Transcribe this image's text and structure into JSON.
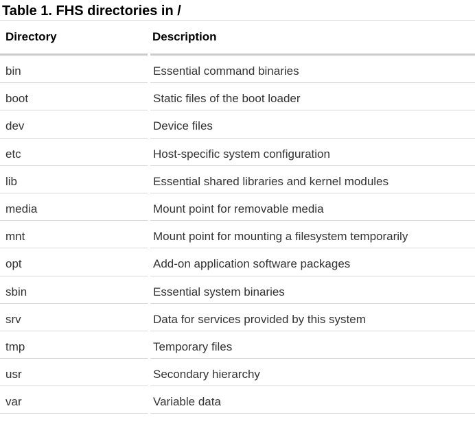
{
  "caption": "Table 1. FHS directories in /",
  "headers": {
    "directory": "Directory",
    "description": "Description"
  },
  "rows": [
    {
      "directory": "bin",
      "description": "Essential command binaries"
    },
    {
      "directory": "boot",
      "description": "Static files of the boot loader"
    },
    {
      "directory": "dev",
      "description": "Device files"
    },
    {
      "directory": "etc",
      "description": "Host-specific system configuration"
    },
    {
      "directory": "lib",
      "description": "Essential shared libraries and kernel modules"
    },
    {
      "directory": "media",
      "description": "Mount point for removable media"
    },
    {
      "directory": "mnt",
      "description": "Mount point for mounting a filesystem temporarily"
    },
    {
      "directory": "opt",
      "description": "Add-on application software packages"
    },
    {
      "directory": "sbin",
      "description": "Essential system binaries"
    },
    {
      "directory": "srv",
      "description": "Data for services provided by this system"
    },
    {
      "directory": "tmp",
      "description": "Temporary files"
    },
    {
      "directory": "usr",
      "description": "Secondary hierarchy"
    },
    {
      "directory": "var",
      "description": "Variable data"
    }
  ]
}
